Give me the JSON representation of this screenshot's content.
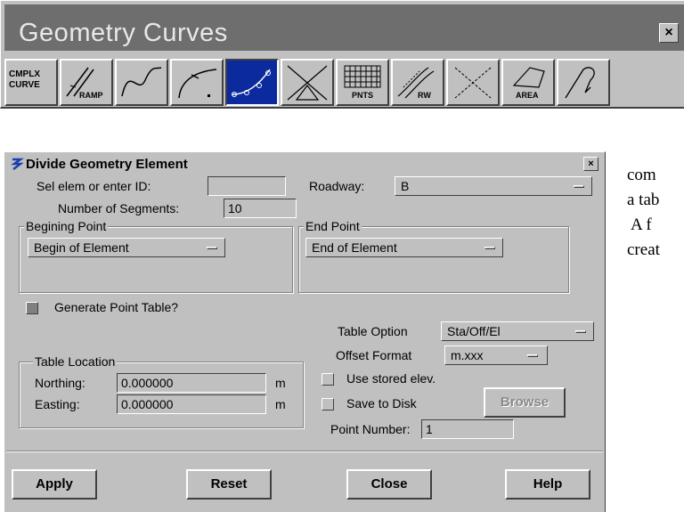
{
  "toolbox": {
    "title": "Geometry Curves",
    "close_label": "×",
    "buttons": [
      {
        "name": "complex-curve",
        "label1": "CMPLX",
        "label2": "CURVE"
      },
      {
        "name": "ramp",
        "label": "RAMP"
      },
      {
        "name": "curve"
      },
      {
        "name": "spiral-point"
      },
      {
        "name": "divide-element",
        "active": true
      },
      {
        "name": "intersect-triangle"
      },
      {
        "name": "points",
        "label": "PNTS"
      },
      {
        "name": "roadway",
        "label": "RW"
      },
      {
        "name": "intersect"
      },
      {
        "name": "area",
        "label": "AREA"
      },
      {
        "name": "freeform"
      }
    ]
  },
  "dialog": {
    "title": "Divide Geometry Element",
    "close_label": "×",
    "sel_elem_label": "Sel elem or enter ID:",
    "sel_elem_value": "",
    "segments_label": "Number of Segments:",
    "segments_value": "10",
    "roadway_label": "Roadway:",
    "roadway_value": "B",
    "begin_group": "Begining Point",
    "begin_value": "Begin of Element",
    "end_group": "End Point",
    "end_value": "End of Element",
    "generate_label": "Generate Point Table?",
    "generate_checked": true,
    "table_location_group": "Table Location",
    "northing_label": "Northing:",
    "northing_value": "0.000000",
    "northing_unit": "m",
    "easting_label": "Easting:",
    "easting_value": "0.000000",
    "easting_unit": "m",
    "table_option_label": "Table Option",
    "table_option_value": "Sta/Off/El",
    "offset_format_label": "Offset Format",
    "offset_format_value": "m.xxx",
    "use_stored_label": "Use stored elev.",
    "save_disk_label": "Save to Disk",
    "browse_label": "Browse",
    "point_number_label": "Point Number:",
    "point_number_value": "1",
    "apply_label": "Apply",
    "reset_label": "Reset",
    "close_button_label": "Close",
    "help_label": "Help"
  },
  "document_text": {
    "line1": "com",
    "line2": "a tab",
    "line3": "A f",
    "line4": "creat"
  },
  "colors": {
    "panel": "#c0c0c0",
    "toolbox_title_bar": "#6e6e6e",
    "active_tool": "#0b2a9e"
  }
}
